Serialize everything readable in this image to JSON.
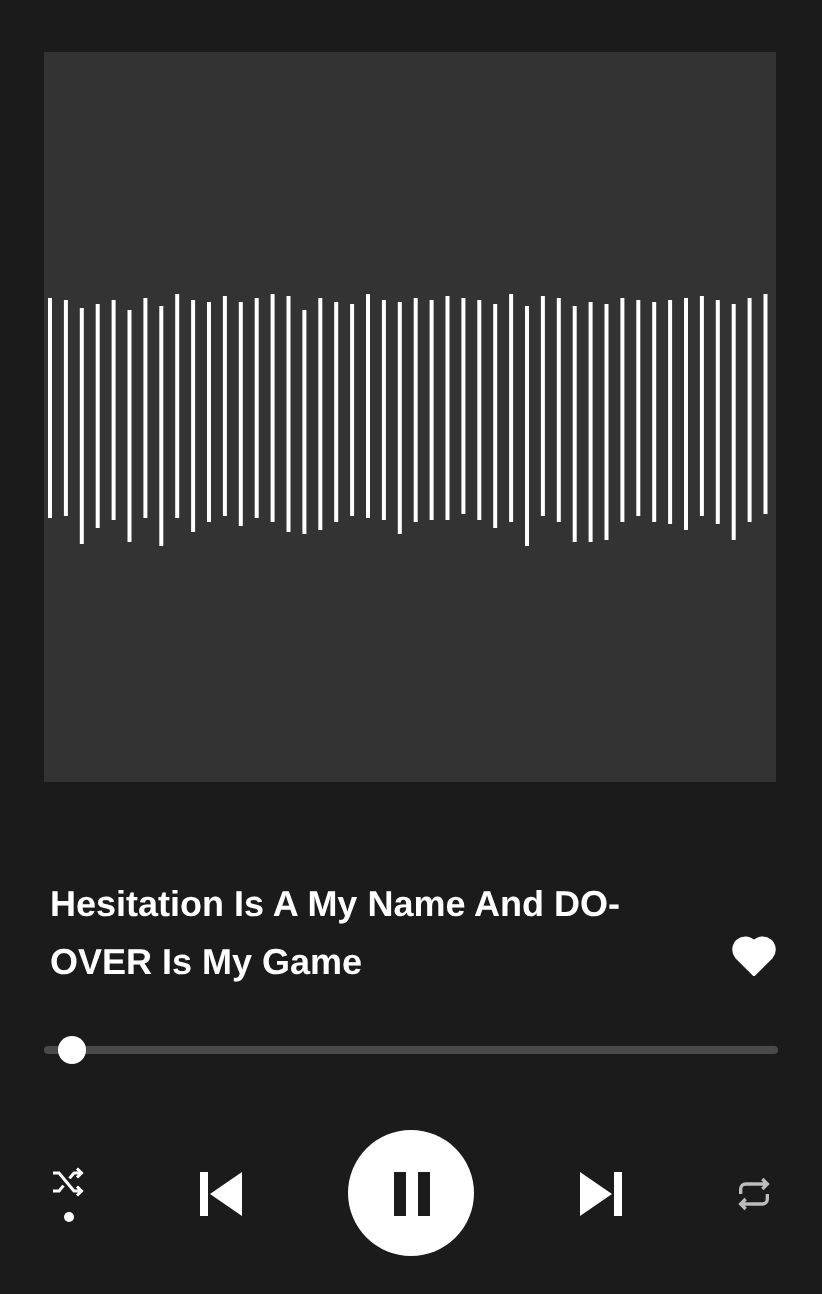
{
  "artwork": {
    "kind": "waveform"
  },
  "track": {
    "title": "Hesitation Is A My Name And DO-OVER Is My Game",
    "liked": true
  },
  "progress": {
    "level": 0.02
  },
  "controls": {
    "shuffle": true,
    "playing": true,
    "repeat": false
  }
}
